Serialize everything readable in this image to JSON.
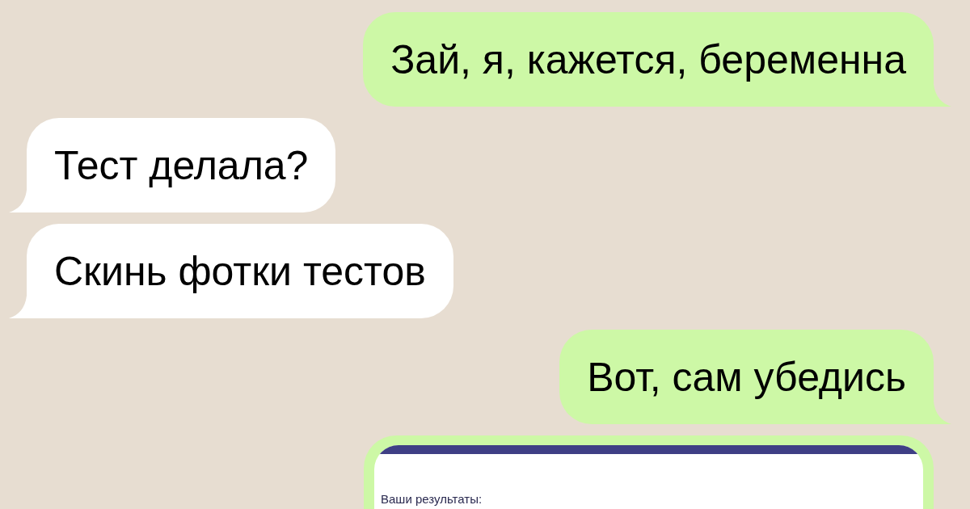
{
  "messages": [
    {
      "kind": "sent",
      "text": "Зай, я, кажется, беременна"
    },
    {
      "kind": "received",
      "text": "Тест делала?"
    },
    {
      "kind": "received",
      "text": "Скинь фотки тестов"
    },
    {
      "kind": "sent",
      "text": "Вот, сам убедись"
    },
    {
      "kind": "sent",
      "attachment": {
        "kind": "screenshot",
        "heading": "Ваши результаты:"
      }
    }
  ]
}
